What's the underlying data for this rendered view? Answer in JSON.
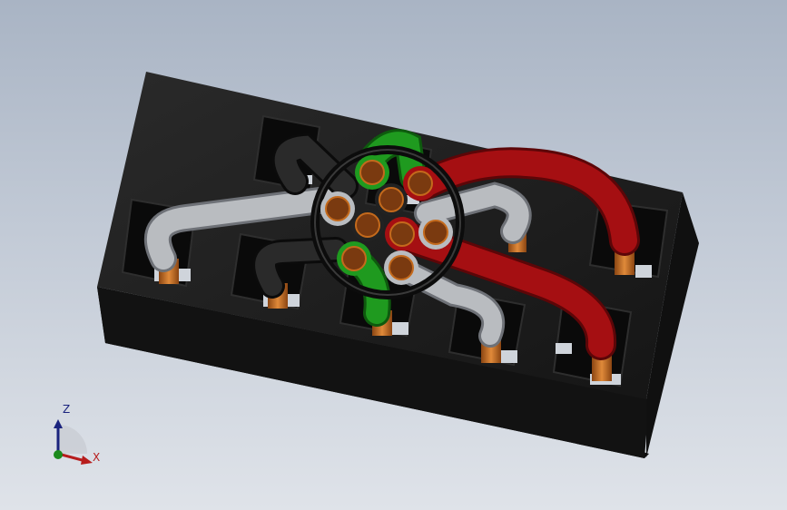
{
  "viewport": {
    "background_top": "#a9b4c4",
    "background_bottom": "#dfe3e9"
  },
  "model": {
    "housing_color": "#1b1b1b",
    "pin_color": "#c46a1c",
    "wire_colors": {
      "red": "#a50f12",
      "green": "#1f9a1f",
      "gray": "#b9bcc0",
      "black": "#222222"
    }
  },
  "triad": {
    "z_label": "Z",
    "x_label": "X",
    "z_color": "#1a237e",
    "x_color": "#b71c1c",
    "y_color": "#1b8a1b"
  }
}
